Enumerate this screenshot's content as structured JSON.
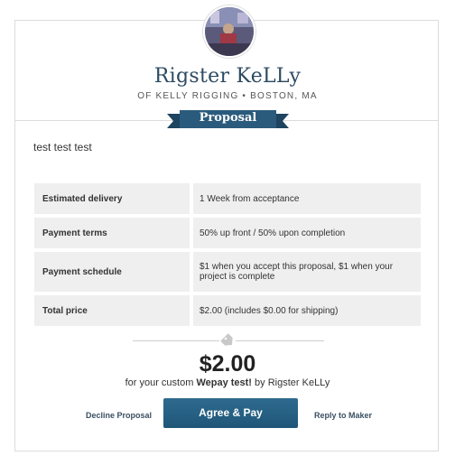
{
  "maker": {
    "name": "Rigster KeLLy",
    "subtitle": "OF KELLY RIGGING • BOSTON, MA"
  },
  "banner": {
    "label": "Proposal"
  },
  "message": "test test test",
  "terms": [
    {
      "key": "Estimated delivery",
      "value": "1 Week from acceptance"
    },
    {
      "key": "Payment terms",
      "value": "50% up front / 50% upon completion"
    },
    {
      "key": "Payment schedule",
      "value": "$1 when you accept this proposal, $1 when your project is complete"
    },
    {
      "key": "Total price",
      "value": "$2.00 (includes $0.00 for shipping)"
    }
  ],
  "summary": {
    "price": "$2.00",
    "for_prefix": "for your custom ",
    "project": "Wepay test!",
    "by_suffix": " by Rigster KeLLy"
  },
  "actions": {
    "decline": "Decline Proposal",
    "agree": "Agree & Pay",
    "reply": "Reply to Maker"
  },
  "colors": {
    "brand": "#2c4a61",
    "button": "#1f5678",
    "ribbon": "#2a5b7c"
  }
}
